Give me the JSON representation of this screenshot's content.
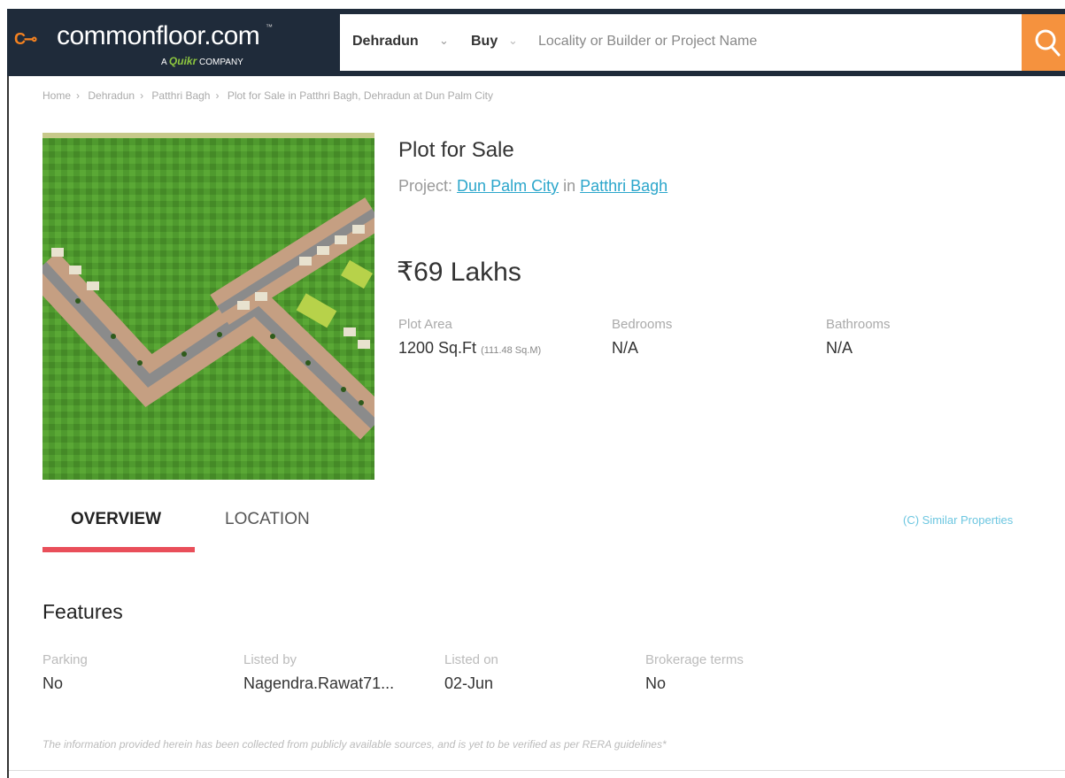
{
  "header": {
    "logo_text": "commonfloor.com",
    "logo_tm": "™",
    "logo_sub_prefix": "A",
    "logo_sub_brand": "Quikr",
    "logo_sub_suffix": "COMPANY",
    "city": "Dehradun",
    "mode": "Buy",
    "search_placeholder": "Locality or Builder or Project Name",
    "accent_color": "#f5923e",
    "bg_color": "#1f2b3a"
  },
  "breadcrumb": [
    "Home",
    "Dehradun",
    "Patthri Bagh",
    "Plot for Sale in Patthri Bagh, Dehradun at Dun Palm City"
  ],
  "listing": {
    "title": "Plot for Sale",
    "project_prefix": "Project:",
    "project_name": "Dun Palm City",
    "project_in": "in",
    "locality": "Patthri Bagh",
    "price": "₹69 Lakhs",
    "specs": [
      {
        "label": "Plot Area",
        "value": "1200 Sq.Ft",
        "sub": "(111.48 Sq.M)"
      },
      {
        "label": "Bedrooms",
        "value": "N/A",
        "sub": ""
      },
      {
        "label": "Bathrooms",
        "value": "N/A",
        "sub": ""
      }
    ]
  },
  "tabs": {
    "overview": "OVERVIEW",
    "location": "LOCATION",
    "similar": "Similar Properties",
    "active_color": "#e94f5a"
  },
  "features": {
    "title": "Features",
    "items": [
      {
        "label": "Parking",
        "value": "No"
      },
      {
        "label": "Listed by",
        "value": "Nagendra.Rawat71..."
      },
      {
        "label": "Listed on",
        "value": "02-Jun"
      },
      {
        "label": "Brokerage terms",
        "value": "No"
      }
    ]
  },
  "disclaimer": "The information provided herein has been collected from publicly available sources, and is yet to be verified as per RERA guidelines*"
}
